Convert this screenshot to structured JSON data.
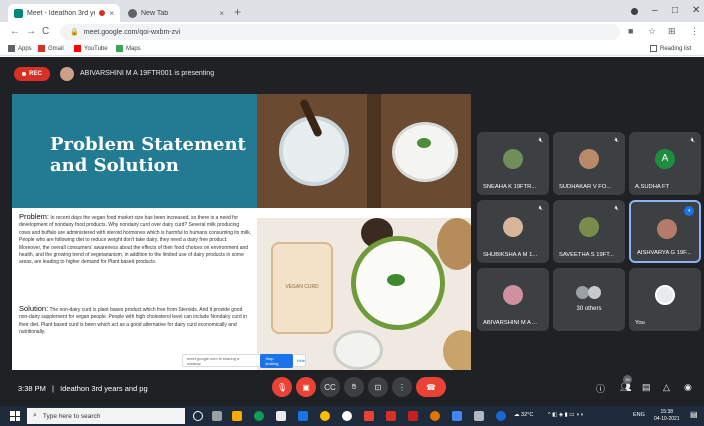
{
  "browser": {
    "tabs": [
      {
        "title": "Meet - Ideathon 3rd years a",
        "favicon_color": "#00897b"
      },
      {
        "title": "New Tab",
        "favicon_color": "#5f6368"
      }
    ],
    "new_tab_symbol": "+",
    "close_symbol": "×",
    "url": "meet.google.com/qoi-wxbm-zvi",
    "window_controls": [
      "–",
      "□",
      "✕"
    ],
    "nav_icons": [
      "←",
      "→",
      "C"
    ],
    "bookmarks": [
      {
        "label": "Apps",
        "color": "#5f6368"
      },
      {
        "label": "Gmail",
        "color": "#d93025"
      },
      {
        "label": "YouTube",
        "color": "#ff0000"
      },
      {
        "label": "Maps",
        "color": "#34a853"
      }
    ],
    "reading_list": "Reading list"
  },
  "meet": {
    "rec_label": "REC",
    "presenter_text": "ABIVARSHINI M A 19FTR001 is presenting",
    "slide": {
      "title_line1": "Problem Statement",
      "title_line2": "and Solution",
      "problem_label": "Problem:",
      "problem_text": " In recent days the vegan food market size has been increased, so there is a need for development of nondairy food products. Why nondairy curd over dairy curd? Several milk producing cows and buffalo are administered with steroid hormones which is harmful to humans consuming its milk. People who are following diet to reduce weight don't take dairy, they need a dairy free product. Moreover, the overall consumers' awareness about the effects of their food choices on environment and health, and the growing trend of vegetarianism, in addition to the limited use of dairy products in some areas, are leading to higher demand for Plant based products.",
      "solution_label": "Solution:",
      "solution_text": " The non-dairy curd is plant bases product which free from Steroids. And it provide good non-dairy supplement for vegan people. People with high cholesterol level can include Nondairy curd in their diet. Plant based curd is been which act as a good alternative for dairy curd economically and nutritionally.",
      "jar_label": "VEGAN CURD",
      "share_text": "meet.google.com is sharing a window.",
      "stop_sharing": "Stop sharing",
      "hide": "Hide"
    },
    "participants": [
      {
        "name": "SNEAHA K 19FTR...",
        "avatar_color": "#6e8e5a"
      },
      {
        "name": "SUDHAKAR V FO...",
        "avatar_color": "#b88a6a"
      },
      {
        "name": "A.SUDHA FT",
        "avatar_letter": "A",
        "avatar_color": "#1e8e3e"
      },
      {
        "name": "SHUBIKSHA A M 1...",
        "avatar_color": "#d7b49a"
      },
      {
        "name": "SAVEETHA S 19FT...",
        "avatar_color": "#7a8c4c"
      },
      {
        "name": "AISHVARYA G 19F...",
        "avatar_color": "#b57a6c"
      },
      {
        "name": "ABIVARSHINI M A ...",
        "avatar_color": "#d18fa0"
      },
      {
        "name": "30 others"
      },
      {
        "name": "You",
        "avatar_color": "#e8eaed"
      }
    ],
    "meeting_time": "3:38 PM",
    "meeting_name": "Ideathon 3rd years and pg",
    "time_separator": "|",
    "people_count": "39",
    "controls": [
      "mic-off",
      "camera-off",
      "captions",
      "raise-hand",
      "present",
      "more",
      "end-call"
    ],
    "right_controls": [
      "info",
      "people",
      "chat",
      "activities",
      "safety"
    ]
  },
  "taskbar": {
    "search_placeholder": "Type here to search",
    "weather": "32°C",
    "lang": "ENG",
    "time": "15:38",
    "date": "04-10-2021"
  }
}
